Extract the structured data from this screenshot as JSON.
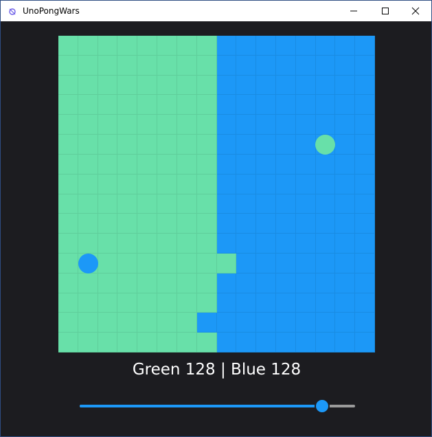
{
  "window": {
    "title": "UnoPongWars"
  },
  "colors": {
    "green": "#68e0a9",
    "blue": "#1c98f7"
  },
  "board": {
    "rows": 16,
    "cols": 16,
    "cells": [
      "GGGGGGGGBBBBBBBB",
      "GGGGGGGGBBBBBBBB",
      "GGGGGGGGBBBBBBBB",
      "GGGGGGGGBBBBBBBB",
      "GGGGGGGGBBBBBBBB",
      "GGGGGGGGBBBBBBBB",
      "GGGGGGGGBBBBBBBB",
      "GGGGGGGGBBBBBBBB",
      "GGGGGGGGBBBBBBBB",
      "GGGGGGGGBBBBBBBB",
      "GGGGGGGGBBBBBBBB",
      "GGGGGGGGGBBBBBBB",
      "GGGGGGGGBBBBBBBB",
      "GGGGGGGGBBBBBBBB",
      "GGGGGGGBBBBBBBBB",
      "GGGGGGGGBBBBBBBB"
    ]
  },
  "balls": [
    {
      "team": "blue",
      "icon": "blue-ball"
    },
    {
      "team": "green",
      "icon": "green-ball"
    }
  ],
  "score": {
    "text": "Green 128 | Blue 128",
    "green": 128,
    "blue": 128
  },
  "speed_slider": {
    "value_fraction": 0.88
  }
}
